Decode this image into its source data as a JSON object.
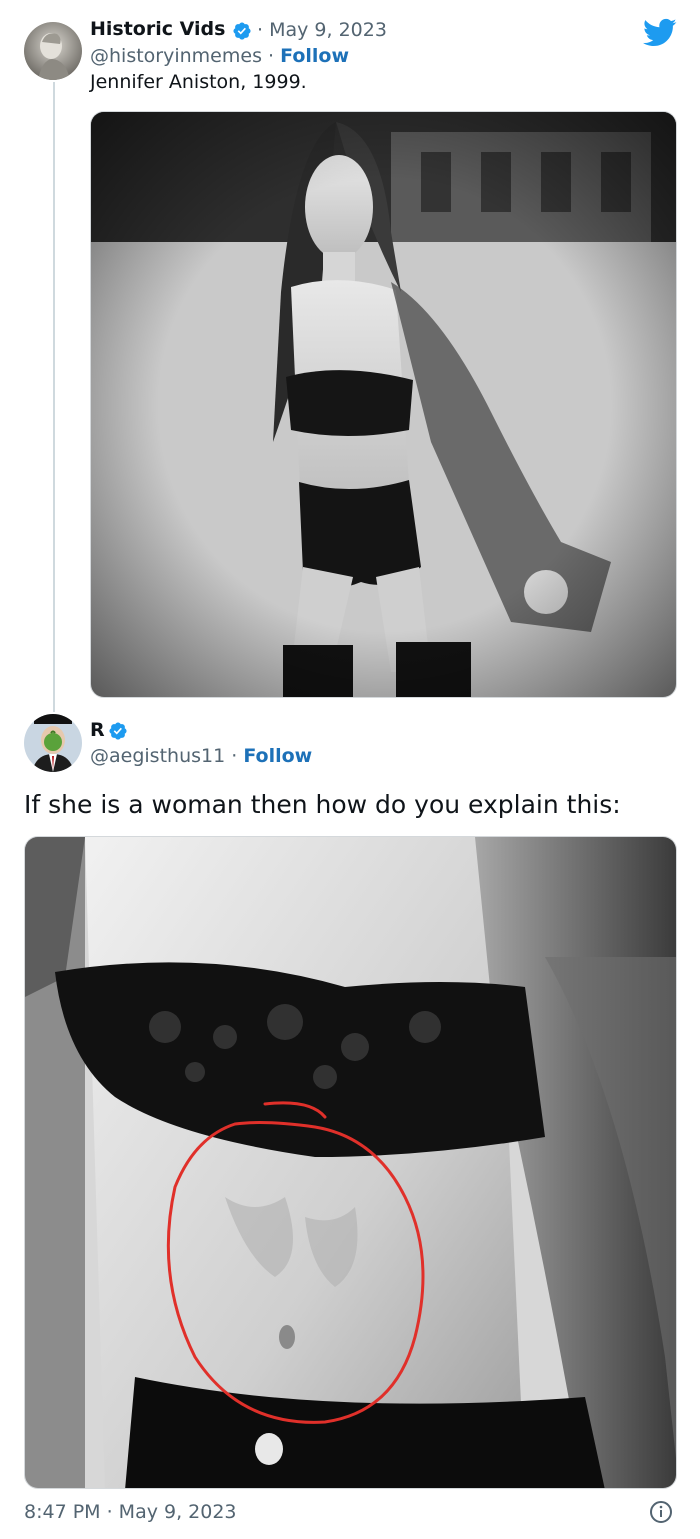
{
  "tweet1": {
    "name": "Historic Vids",
    "date": "May 9, 2023",
    "handle": "@historyinmemes",
    "follow_label": "Follow",
    "separator": "·",
    "text": "Jennifer Aniston, 1999."
  },
  "tweet2": {
    "name": "R",
    "handle": "@aegisthus11",
    "follow_label": "Follow",
    "separator": "·",
    "text": "If she is a woman then how do you explain this:",
    "timestamp": "8:47 PM · May 9, 2023"
  },
  "colors": {
    "text": "#0f1419",
    "secondary": "#536471",
    "follow": "#1d71b8",
    "verified": "#1d9bf0",
    "twitter": "#1d9bf0",
    "thread_line": "#cfd9de",
    "annotation": "#e0302a"
  },
  "icons": {
    "verified": "verified-badge-icon",
    "brand": "twitter-bird-icon",
    "info": "info-icon"
  }
}
